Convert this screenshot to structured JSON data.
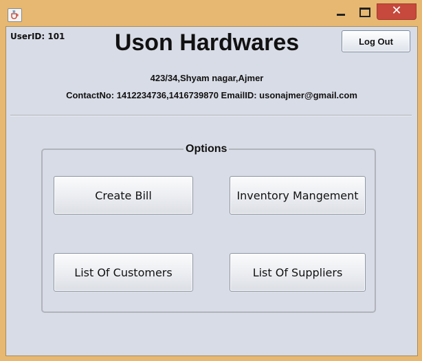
{
  "window": {
    "title": "",
    "close_glyph": "✕"
  },
  "header": {
    "user_id": "UserID: 101",
    "logout_label": "Log Out",
    "title": "Uson Hardwares",
    "address": "423/34,Shyam nagar,Ajmer",
    "contact": "ContactNo: 1412234736,1416739870  EmailID: usonajmer@gmail.com"
  },
  "options": {
    "title": "Options",
    "buttons": [
      {
        "label": "Create Bill"
      },
      {
        "label": "Inventory Mangement"
      },
      {
        "label": "List Of Customers"
      },
      {
        "label": "List Of Suppliers"
      }
    ]
  },
  "icons": {
    "app": "java-cup-icon",
    "minimize": "minimize-icon",
    "maximize": "maximize-icon",
    "close": "close-icon"
  },
  "colors": {
    "frame": "#e7b872",
    "panel": "#d8dce6",
    "close": "#c7483c"
  }
}
